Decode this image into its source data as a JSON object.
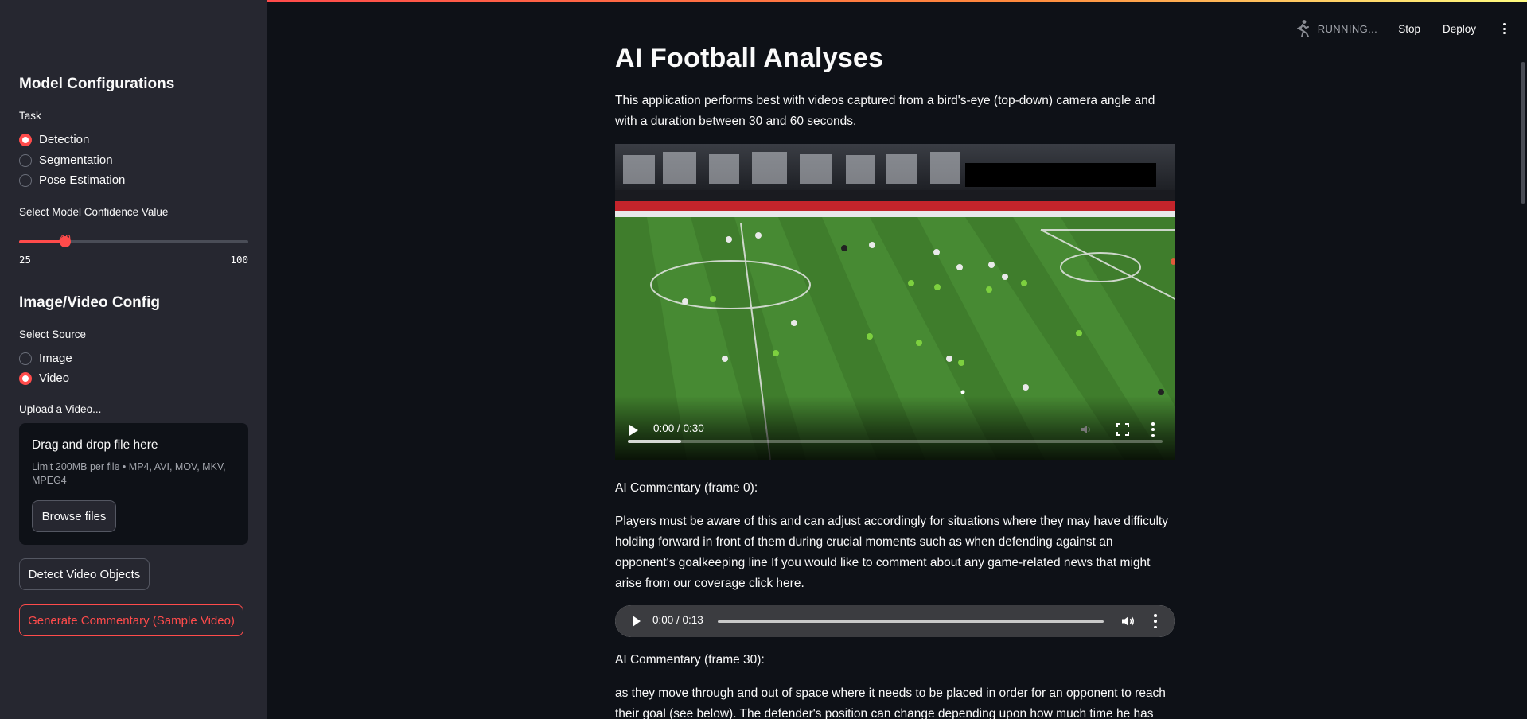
{
  "header": {
    "status_text": "RUNNING...",
    "stop_label": "Stop",
    "deploy_label": "Deploy",
    "accent_color": "#ff4b4b"
  },
  "sidebar": {
    "model_heading": "Model Configurations",
    "task_label": "Task",
    "task_options": [
      "Detection",
      "Segmentation",
      "Pose Estimation"
    ],
    "task_selected": "Detection",
    "confidence_label": "Select Model Confidence Value",
    "confidence": {
      "value": "40",
      "min": "25",
      "max": "100"
    },
    "source_heading": "Image/Video Config",
    "source_label": "Select Source",
    "source_options": [
      "Image",
      "Video"
    ],
    "source_selected": "Video",
    "upload_label": "Upload a Video...",
    "dropzone_title": "Drag and drop file here",
    "dropzone_limit": "Limit 200MB per file • MP4, AVI, MOV, MKV, MPEG4",
    "browse_label": "Browse files",
    "detect_label": "Detect Video Objects",
    "generate_label": "Generate Commentary (Sample Video)"
  },
  "main": {
    "title": "AI Football Analyses",
    "intro": "This application performs best with videos captured from a bird's-eye (top-down) camera angle and with a duration between 30 and 60 seconds.",
    "video": {
      "time": "0:00 / 0:30",
      "progress": 0.1
    },
    "commentary_0_label": "AI Commentary (frame 0):",
    "commentary_0_text": "Players must be aware of this and can adjust accordingly for situations where they may have difficulty holding forward in front of them during crucial moments such as when defending against an opponent's goalkeeping line If you would like to comment about any game-related news that might arise from our coverage click here.",
    "audio": {
      "time": "0:00 / 0:13"
    },
    "commentary_30_label": "AI Commentary (frame 30):",
    "commentary_30_text": "as they move through and out of space where it needs to be placed in order for an opponent to reach their goal (see below). The defender's position can change depending upon how much time he has spent with"
  }
}
